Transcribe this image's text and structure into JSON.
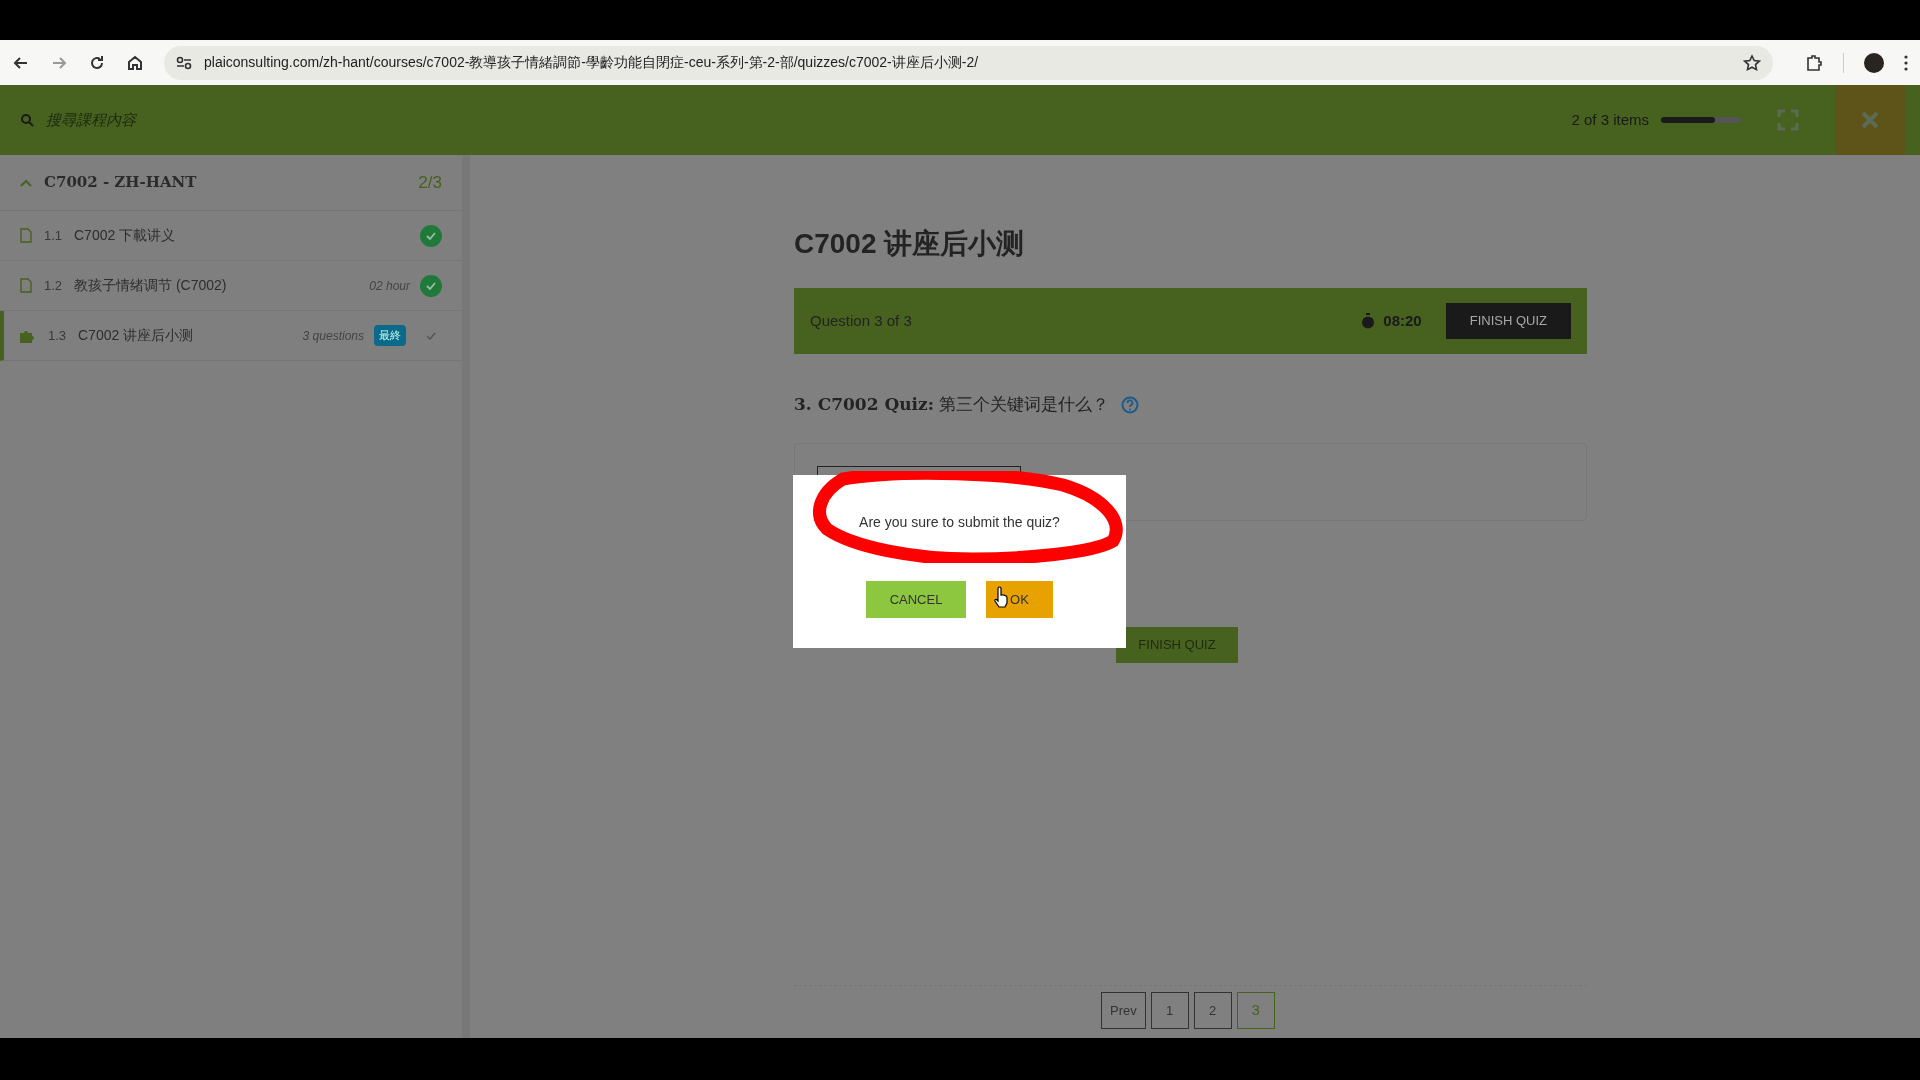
{
  "browser": {
    "url": "plaiconsulting.com/zh-hant/courses/c7002-教導孩子情緒調節-學齡功能自閉症-ceu-系列-第-2-部/quizzes/c7002-讲座后小测-2/"
  },
  "header": {
    "search_placeholder": "搜尋課程內容",
    "progress_text": "2 of 3 items",
    "level": 0.67
  },
  "sidebar": {
    "section": {
      "title": "C7002 - ZH-HANT",
      "count": "2/3",
      "expanded": true
    },
    "items": [
      {
        "kind": "lesson",
        "number": "1.1",
        "title": "C7002 下載讲义",
        "completed": true,
        "selected": false
      },
      {
        "kind": "lesson",
        "number": "1.2",
        "title": "教孩子情绪调节 (C7002)",
        "meta": "02 hour",
        "completed": true,
        "selected": false
      },
      {
        "kind": "quiz",
        "number": "1.3",
        "title": "C7002 讲座后小测",
        "meta": "3 questions",
        "badge": "最終",
        "completed": false,
        "selected": true
      }
    ]
  },
  "quiz": {
    "title": "C7002 讲座后小测",
    "status": "Question 3 of 3",
    "timer": "08:20",
    "finish_button": "FINISH QUIZ",
    "question_number": "3. C7002 Quiz:",
    "question_text": "第三个关键词是什么？",
    "bottom_finish_button": "FINISH QUIZ",
    "pages": [
      {
        "label": "Prev",
        "selected": false
      },
      {
        "label": "1",
        "selected": false
      },
      {
        "label": "2",
        "selected": false
      },
      {
        "label": "3",
        "selected": true
      }
    ]
  },
  "dialog": {
    "message": "Are you sure to submit the quiz?",
    "buttons": [
      {
        "kind": "cancel",
        "label": "CANCEL"
      },
      {
        "kind": "ok",
        "label": "OK"
      }
    ]
  }
}
